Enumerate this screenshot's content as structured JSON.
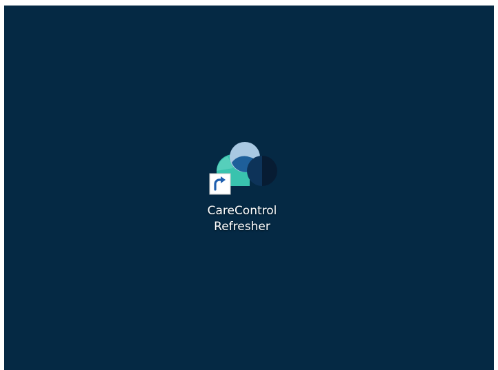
{
  "desktop": {
    "background_color": "#052944",
    "shortcut": {
      "label_line1": "CareControl",
      "label_line2": "Refresher",
      "icon": "carecontrol-app-icon",
      "overlay_icon": "shortcut-arrow-icon",
      "colors": {
        "teal": "#39C3AE",
        "light_blue": "#A9C8E2",
        "mid_blue": "#1E5F9A",
        "navy": "#0D3359",
        "dark_navy": "#071C33"
      }
    }
  }
}
